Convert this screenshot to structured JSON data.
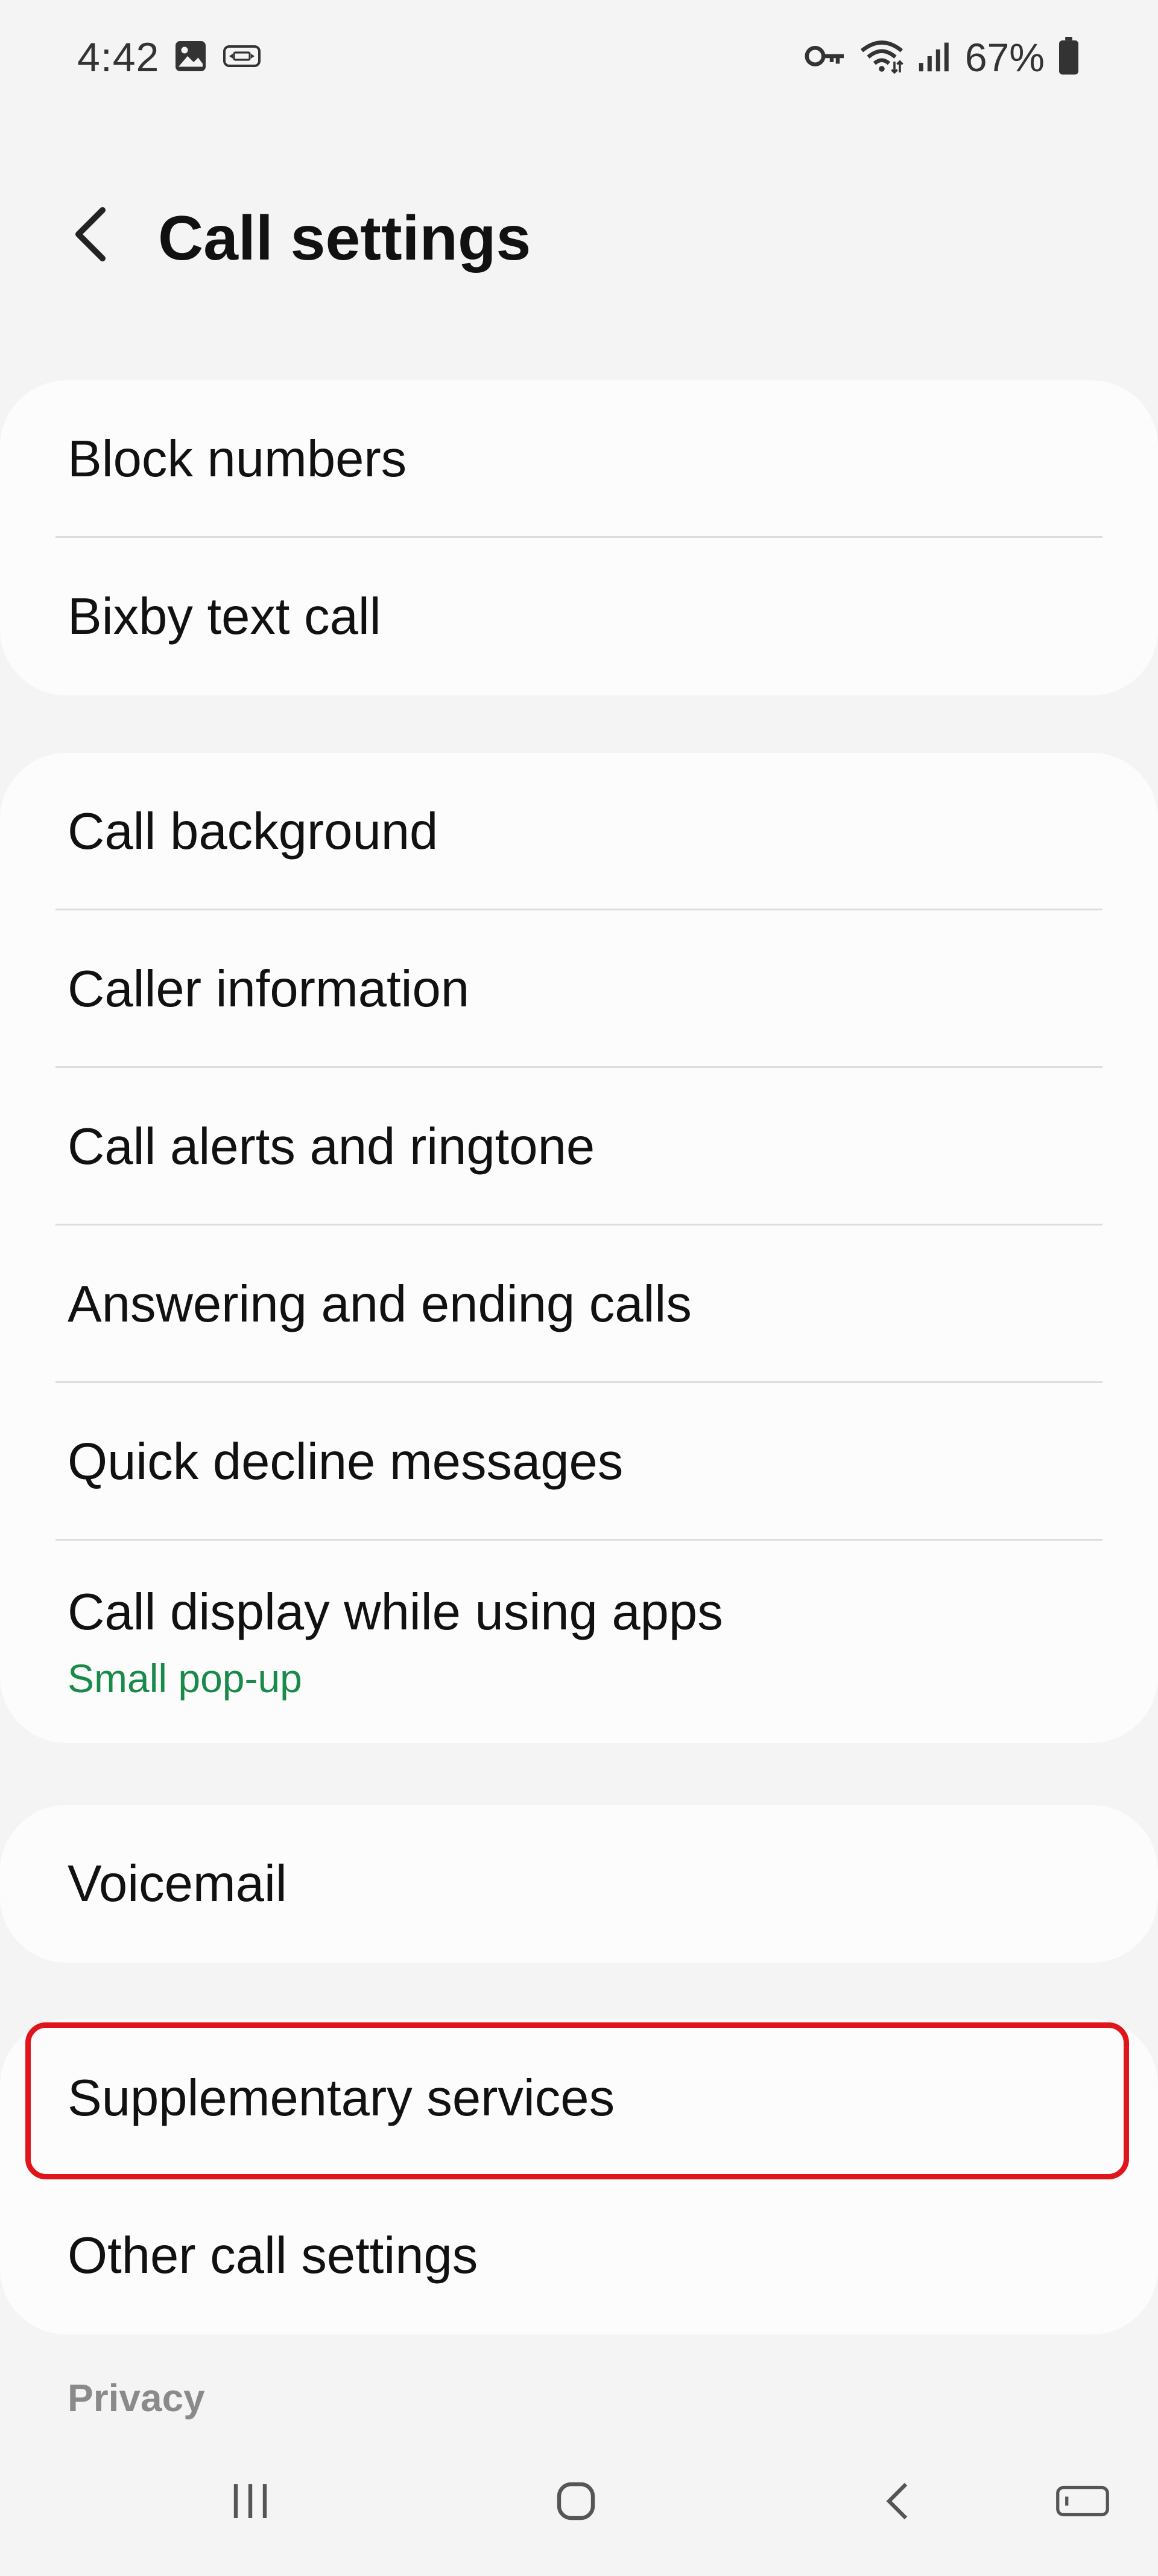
{
  "status_bar": {
    "time": "4:42",
    "battery_percent": "67%",
    "icons": [
      "image-icon",
      "cast-icon",
      "vpn-key-icon",
      "wifi-icon",
      "signal-icon",
      "battery-icon"
    ]
  },
  "header": {
    "title": "Call settings",
    "back_icon": "chevron-left-icon"
  },
  "groups": [
    {
      "items": [
        {
          "label": "Block numbers"
        },
        {
          "label": "Bixby text call"
        }
      ]
    },
    {
      "items": [
        {
          "label": "Call background"
        },
        {
          "label": "Caller information"
        },
        {
          "label": "Call alerts and ringtone"
        },
        {
          "label": "Answering and ending calls"
        },
        {
          "label": "Quick decline messages"
        },
        {
          "label": "Call display while using apps",
          "sublabel": "Small pop-up"
        }
      ]
    },
    {
      "items": [
        {
          "label": "Voicemail"
        }
      ]
    },
    {
      "items": [
        {
          "label": "Supplementary services",
          "highlighted": true
        },
        {
          "label": "Other call settings"
        }
      ]
    }
  ],
  "section_header": "Privacy",
  "colors": {
    "background": "#f4f4f4",
    "card": "#fcfcfc",
    "accent_green": "#1a8a4a",
    "highlight_red": "#e0151b"
  },
  "nav_bar": {
    "icons": [
      "recent-apps-icon",
      "home-icon",
      "back-icon",
      "keyboard-icon"
    ]
  }
}
